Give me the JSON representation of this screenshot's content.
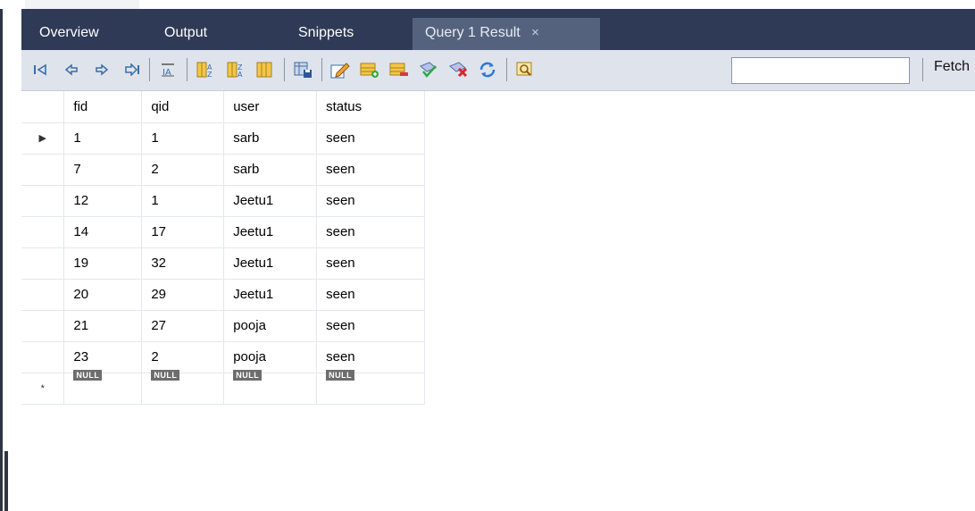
{
  "tabs": [
    {
      "label": "Overview"
    },
    {
      "label": "Output"
    },
    {
      "label": "Snippets"
    },
    {
      "label": "Query 1 Result",
      "active": true
    }
  ],
  "tab_close_glyph": "×",
  "toolbar": {
    "icons": [
      "first-record-icon",
      "previous-record-icon",
      "next-record-icon",
      "last-record-icon",
      "text-align-icon",
      "sort-ascending-icon",
      "sort-descending-icon",
      "refresh-columns-icon",
      "export-icon",
      "edit-row-icon",
      "insert-row-icon",
      "delete-row-icon",
      "apply-changes-icon",
      "discard-changes-icon",
      "refresh-icon",
      "filter-icon"
    ],
    "search_value": "",
    "fetch_label": "Fetch"
  },
  "grid": {
    "columns": [
      "fid",
      "qid",
      "user",
      "status"
    ],
    "rows": [
      [
        "1",
        "1",
        "sarb",
        "seen"
      ],
      [
        "7",
        "2",
        "sarb",
        "seen"
      ],
      [
        "12",
        "1",
        "Jeetu1",
        "seen"
      ],
      [
        "14",
        "17",
        "Jeetu1",
        "seen"
      ],
      [
        "19",
        "32",
        "Jeetu1",
        "seen"
      ],
      [
        "20",
        "29",
        "Jeetu1",
        "seen"
      ],
      [
        "21",
        "27",
        "pooja",
        "seen"
      ],
      [
        "23",
        "2",
        "pooja",
        "seen"
      ]
    ],
    "null_label": "NULL",
    "current_row_marker": "▶",
    "new_row_marker": "*"
  }
}
